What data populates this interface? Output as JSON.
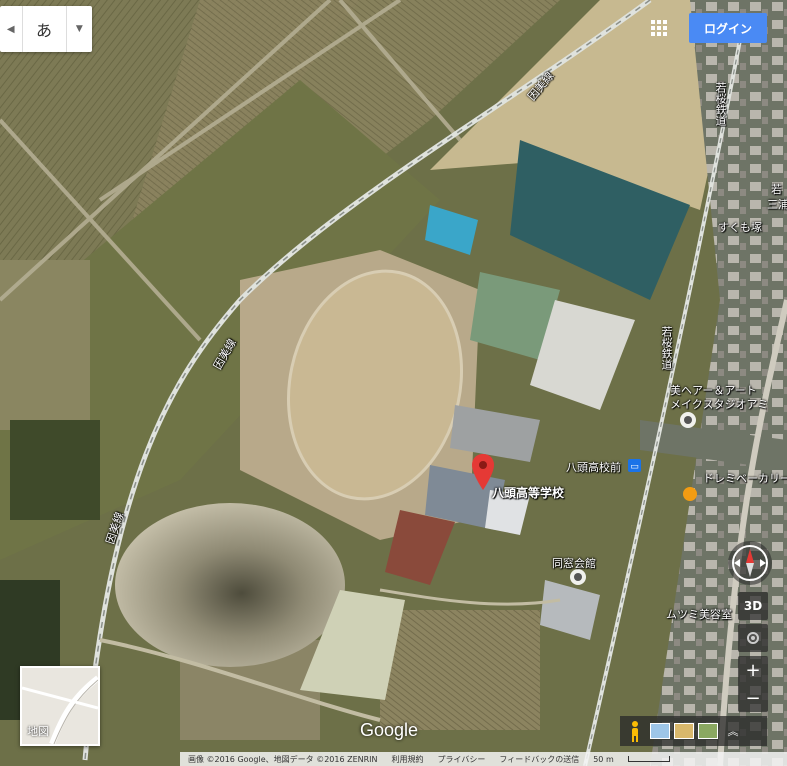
{
  "toolbar": {
    "ime_char": "あ",
    "login_label": "ログイン"
  },
  "labels": {
    "school": "八頭高等学校",
    "station": "八頭高校前",
    "hall": "同窓会館",
    "rail1": "因美線",
    "rail2": "因美線",
    "rail3": "因美線",
    "rail4": "若桜鉄道",
    "rail5": "若桜鉄道",
    "sukumozuka": "すくも塚",
    "salon_line1": "美ヘアー＆アート",
    "salon_line2": "メイクスタジオアミ",
    "bakery": "ドレミベーカリー",
    "beauty": "ムツミ美容室",
    "edge1": "若",
    "edge2": "三浦"
  },
  "minimap": {
    "label": "地図"
  },
  "controls": {
    "threed": "3D",
    "zoom_in": "+",
    "zoom_out": "−"
  },
  "brand": "Google",
  "footer": {
    "copyright": "画像 ©2016 Google、地図データ ©2016 ZENRIN",
    "terms": "利用規約",
    "privacy": "プライバシー",
    "feedback": "フィードバックの送信",
    "scale": "50 m"
  },
  "colors": {
    "accent_blue": "#4a8af4",
    "pin_red": "#e53935"
  }
}
